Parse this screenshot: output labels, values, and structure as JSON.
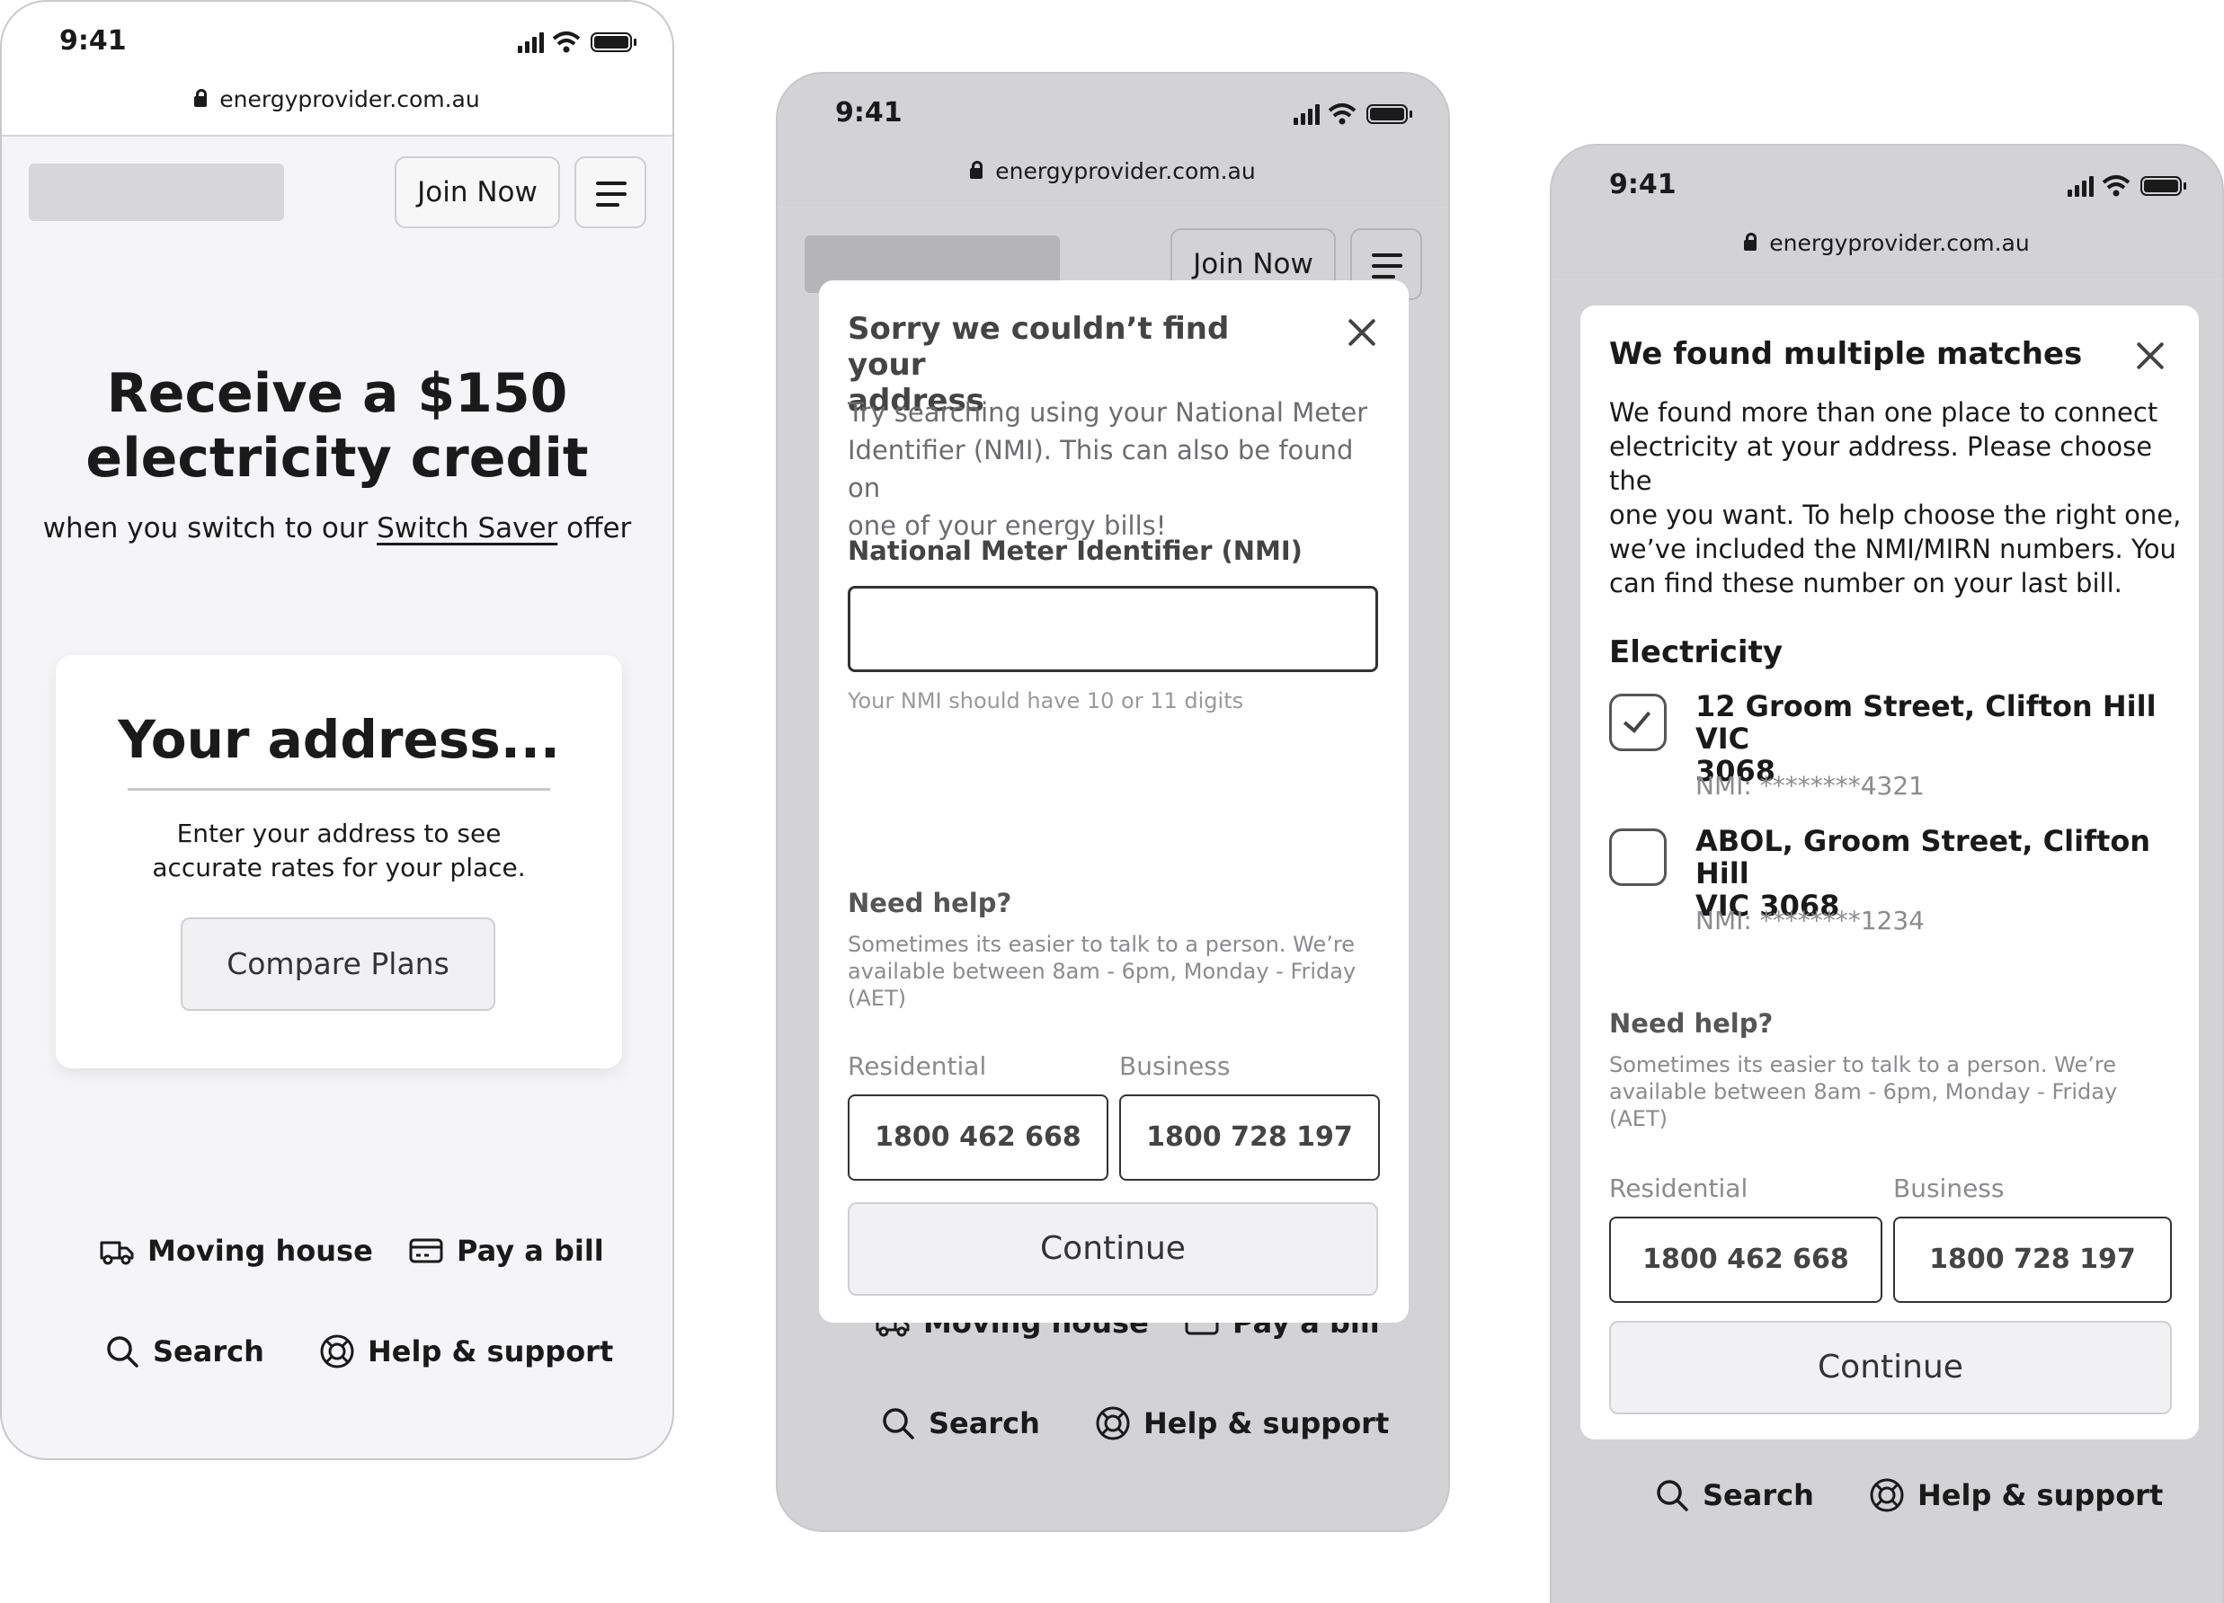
{
  "status": {
    "time": "9:41",
    "url": "energyprovider.com.au"
  },
  "header": {
    "join_label": "Join Now"
  },
  "screen1": {
    "hero_line1": "Receive a $150",
    "hero_line2": "electricity credit",
    "sub_before": "when you switch to our ",
    "sub_link": "Switch Saver",
    "sub_after": " offer",
    "card_title": "Your address...",
    "card_text_line1": "Enter your address to see",
    "card_text_line2": "accurate rates for your place.",
    "compare_label": "Compare Plans"
  },
  "footer_links": {
    "moving": "Moving house",
    "pay": "Pay a bill",
    "search": "Search",
    "help": "Help & support"
  },
  "screen2": {
    "title_line1": "Sorry we couldn’t find your",
    "title_line2": "address",
    "text_line1": "Try searching using your National Meter",
    "text_line2": "Identifier (NMI). This can also be found on",
    "text_line3": "one of your energy bills!",
    "field_label": "National Meter Identifier (NMI)",
    "field_value": "",
    "hint": "Your NMI should have 10 or 11 digits"
  },
  "screen3": {
    "title": "We found multiple matches",
    "text_line1": "We found more than one place to connect",
    "text_line2": "electricity at your address. Please choose the",
    "text_line3": "one you want. To help choose the right one,",
    "text_line4": "we’ve included the NMI/MIRN numbers. You",
    "text_line5": "can find these number on your last bill.",
    "section": "Electricity",
    "options": [
      {
        "line1": "12 Groom Street, Clifton Hill VIC",
        "line2": "3068",
        "nmi": "NMI: ********4321",
        "checked": true
      },
      {
        "line1": "ABOL, Groom Street, Clifton Hill",
        "line2": "VIC 3068",
        "nmi": "NMI: ********1234",
        "checked": false
      }
    ]
  },
  "help": {
    "title": "Need help?",
    "text_line1": "Sometimes its easier to talk to a person. We’re",
    "text_line2": "available between 8am - 6pm, Monday - Friday",
    "text_line3": "(AET)",
    "residential_label": "Residential",
    "business_label": "Business",
    "residential_number": "1800 462 668",
    "business_number": "1800 728 197",
    "continue_label": "Continue"
  }
}
